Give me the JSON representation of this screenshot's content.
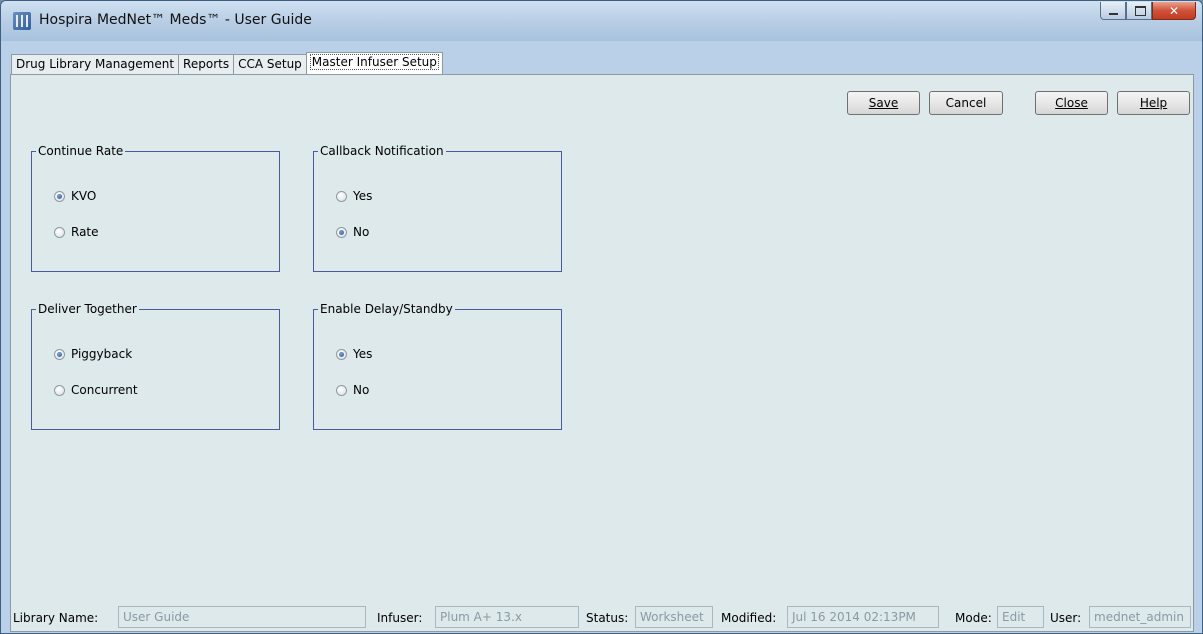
{
  "window": {
    "title": "Hospira MedNet™ Meds™ - User Guide"
  },
  "tabs": [
    {
      "label": "Drug Library Management"
    },
    {
      "label": "Reports"
    },
    {
      "label": "CCA Setup"
    },
    {
      "label": "Master Infuser Setup",
      "active": true
    }
  ],
  "toolbar": {
    "save_label": "Save",
    "cancel_label": "Cancel",
    "close_label": "Close",
    "help_label": "Help"
  },
  "groups": {
    "continue_rate": {
      "title": "Continue Rate",
      "options": [
        {
          "label": "KVO",
          "selected": true
        },
        {
          "label": "Rate",
          "selected": false
        }
      ]
    },
    "callback_notification": {
      "title": "Callback Notification",
      "options": [
        {
          "label": "Yes",
          "selected": false
        },
        {
          "label": "No",
          "selected": true
        }
      ]
    },
    "deliver_together": {
      "title": "Deliver Together",
      "options": [
        {
          "label": "Piggyback",
          "selected": true
        },
        {
          "label": "Concurrent",
          "selected": false
        }
      ]
    },
    "enable_delay_standby": {
      "title": "Enable Delay/Standby",
      "options": [
        {
          "label": "Yes",
          "selected": true
        },
        {
          "label": "No",
          "selected": false
        }
      ]
    }
  },
  "status": {
    "library_name_label": "Library Name:",
    "library_name_value": "User Guide",
    "infuser_label": "Infuser:",
    "infuser_value": "Plum A+ 13.x",
    "status_label": "Status:",
    "status_value": "Worksheet",
    "modified_label": "Modified:",
    "modified_value": "Jul 16 2014 02:13PM",
    "mode_label": "Mode:",
    "mode_value": "Edit",
    "user_label": "User:",
    "user_value": "mednet_admin"
  },
  "colors": {
    "panel_bg": "#dde9eb",
    "group_border": "#4b5aa0",
    "titlebar": "#b9d0e8",
    "close_button": "#c23b22"
  }
}
